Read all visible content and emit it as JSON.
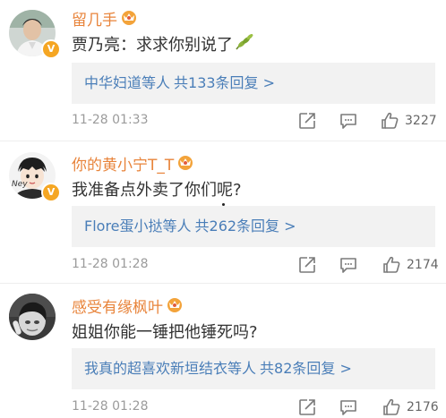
{
  "comments": [
    {
      "username": "留几手",
      "text": "贾乃亮：求求你别说了",
      "reply_names": "中华妇道等人",
      "reply_count": "共133条回复 >",
      "time": "11-28 01:33",
      "likes": "3227",
      "verified": "V"
    },
    {
      "username": "你的黄小宁T_T",
      "text": "我准备点外卖了你们呢?",
      "reply_names": "Flore蛋小挞等人",
      "reply_count": "共262条回复 >",
      "time": "11-28 01:28",
      "likes": "2174",
      "verified": "V"
    },
    {
      "username": "感受有缘枫叶",
      "text": "姐姐你能一锤把他锤死吗?",
      "reply_names": "我真的超喜欢新垣结衣等人",
      "reply_count": "共82条回复 >",
      "time": "11-28 01:28",
      "likes": "2176"
    }
  ],
  "icons": {
    "crown": "crown-badge-icon",
    "share": "share-icon",
    "comment": "comment-icon",
    "like": "thumbs-up-icon",
    "leaf": "leaf-emoji-icon"
  },
  "colors": {
    "username": "#e8843b",
    "link": "#4a7eb8",
    "meta": "#9b9b9b",
    "reply_bg": "#f2f2f2",
    "verified": "#f5a623"
  }
}
